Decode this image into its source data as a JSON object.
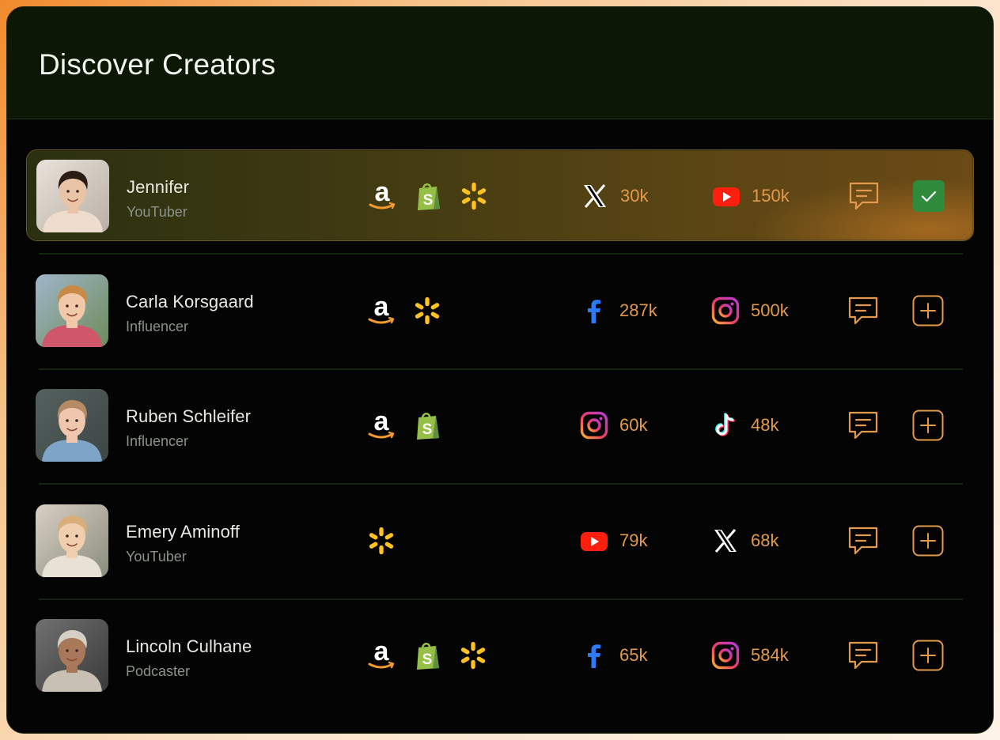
{
  "title": "Discover Creators",
  "colors": {
    "accent": "#e39a4c",
    "header_bg": "#0c1706",
    "card_bg": "#030403",
    "check_green": "#2f8a3b"
  },
  "creators": [
    {
      "name": "Jennifer",
      "role": "YouTuber",
      "selected": true,
      "shops": [
        "amazon-icon",
        "shopify-icon",
        "walmart-icon"
      ],
      "stats": [
        {
          "platform": "x-icon",
          "value": "30k"
        },
        {
          "platform": "youtube-icon",
          "value": "150k"
        }
      ],
      "action": "check-icon"
    },
    {
      "name": "Carla Korsgaard",
      "role": "Influencer",
      "selected": false,
      "shops": [
        "amazon-icon",
        "walmart-icon"
      ],
      "stats": [
        {
          "platform": "facebook-icon",
          "value": "287k"
        },
        {
          "platform": "instagram-icon",
          "value": "500k"
        }
      ],
      "action": "plus-icon"
    },
    {
      "name": "Ruben Schleifer",
      "role": "Influencer",
      "selected": false,
      "shops": [
        "amazon-icon",
        "shopify-icon"
      ],
      "stats": [
        {
          "platform": "instagram-icon",
          "value": "60k"
        },
        {
          "platform": "tiktok-icon",
          "value": "48k"
        }
      ],
      "action": "plus-icon"
    },
    {
      "name": "Emery Aminoff",
      "role": "YouTuber",
      "selected": false,
      "shops": [
        "walmart-icon"
      ],
      "stats": [
        {
          "platform": "youtube-icon",
          "value": "79k"
        },
        {
          "platform": "x-icon",
          "value": "68k"
        }
      ],
      "action": "plus-icon"
    },
    {
      "name": "Lincoln Culhane",
      "role": "Podcaster",
      "selected": false,
      "shops": [
        "amazon-icon",
        "shopify-icon",
        "walmart-icon"
      ],
      "stats": [
        {
          "platform": "facebook-icon",
          "value": "65k"
        },
        {
          "platform": "instagram-icon",
          "value": "584k"
        }
      ],
      "action": "plus-icon"
    }
  ]
}
